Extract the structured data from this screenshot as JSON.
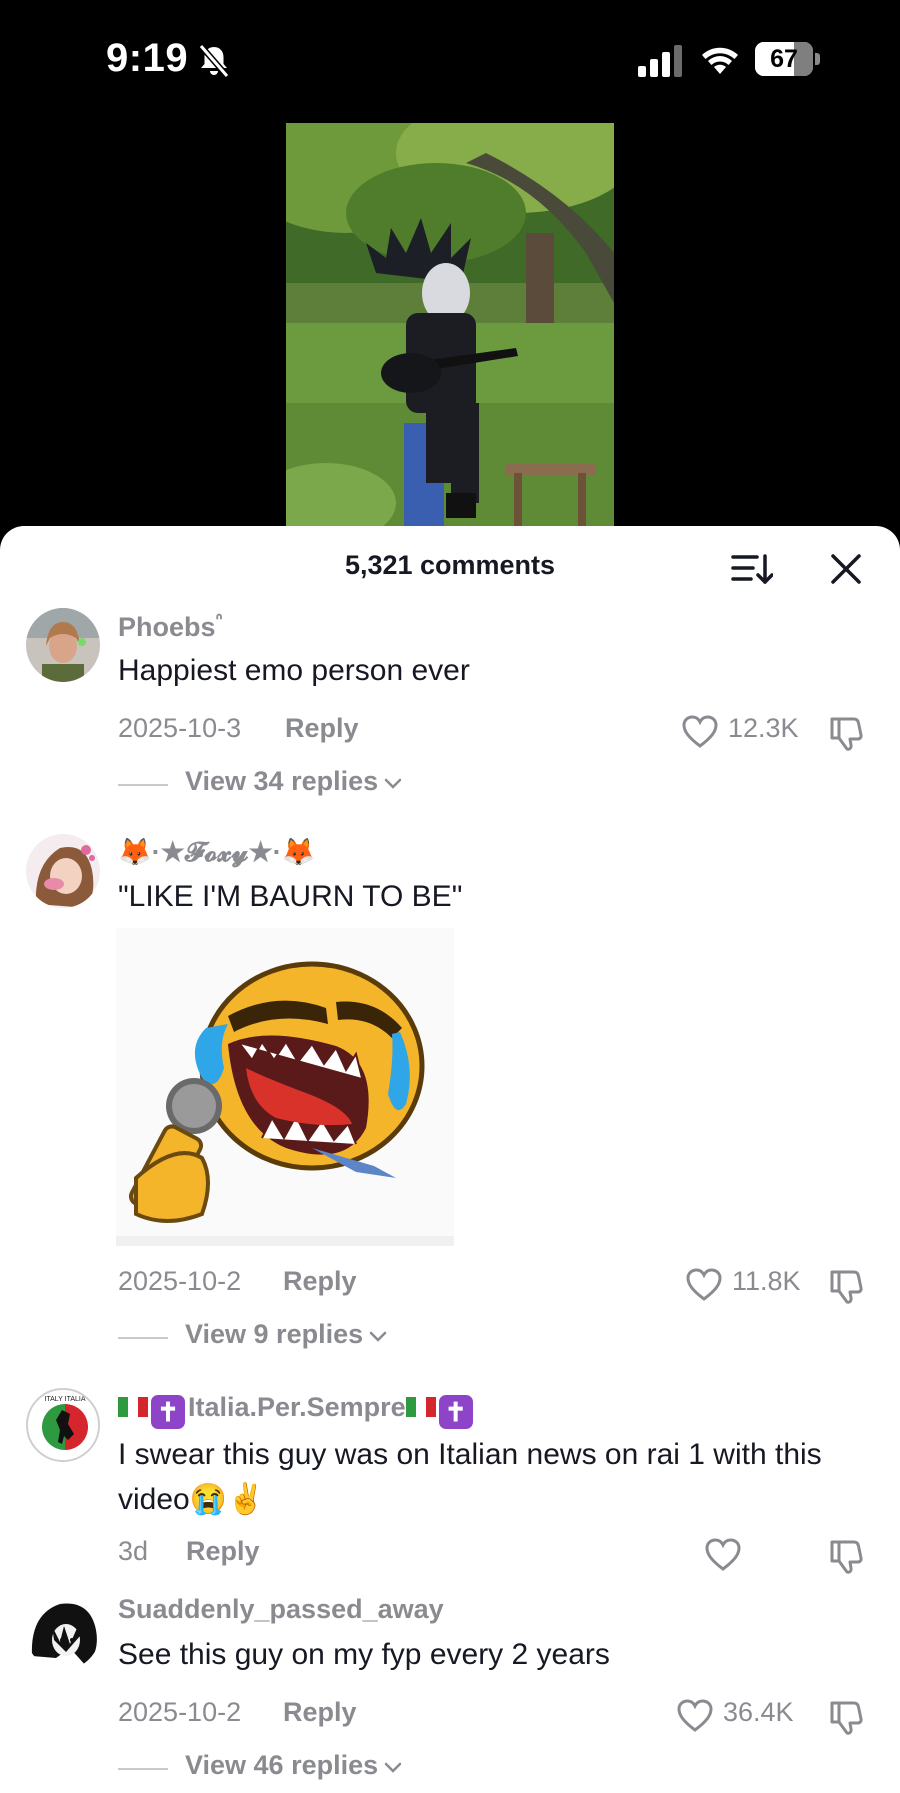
{
  "status": {
    "time": "9:19",
    "battery": "67",
    "battery_level": 0.67
  },
  "header": {
    "comments_count": "5,321 comments"
  },
  "comments": [
    {
      "username": "Phoebs",
      "username_suffix": "ᐢ",
      "text": "Happiest emo person ever",
      "date": "2025-10-3",
      "reply": "Reply",
      "likes": "12.3K",
      "view_replies": "View 34 replies"
    },
    {
      "username": "🦊·★𝓕𝓸𝔁𝔂★·🦊",
      "text": "\"LIKE I'M BAURN TO BE\"",
      "date": "2025-10-2",
      "reply": "Reply",
      "likes": "11.8K",
      "view_replies": "View 9 replies"
    },
    {
      "username": "Italia.Per.Sempre",
      "text": "I swear this guy was on Italian news on rai 1 with this video😭✌️",
      "date": "3d",
      "reply": "Reply",
      "likes": ""
    },
    {
      "username": "Suaddenly_passed_away",
      "text": "See this guy on my fyp every 2 years",
      "date": "2025-10-2",
      "reply": "Reply",
      "likes": "36.4K",
      "view_replies": "View 46 replies"
    }
  ],
  "avatar_logo_text": "ITALY ITALIA",
  "colors": {
    "muted": "#8a8b91",
    "text": "#161823",
    "blue_tears": "#2ea6e8",
    "emoji_yellow": "#f4b52a"
  }
}
